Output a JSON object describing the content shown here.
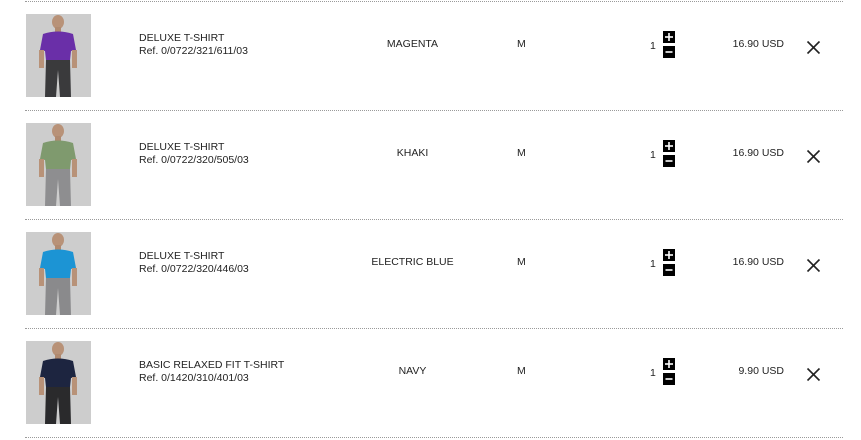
{
  "items": [
    {
      "name": "DELUXE T-SHIRT",
      "ref": "Ref. 0/0722/321/611/03",
      "color": "MAGENTA",
      "size": "M",
      "quantity": "1",
      "price": "16.90 USD",
      "shirt_color": "#6a2fa8",
      "pants_color": "#3a3a3c"
    },
    {
      "name": "DELUXE T-SHIRT",
      "ref": "Ref. 0/0722/320/505/03",
      "color": "KHAKI",
      "size": "M",
      "quantity": "1",
      "price": "16.90 USD",
      "shirt_color": "#7f9a6e",
      "pants_color": "#8e8e90"
    },
    {
      "name": "DELUXE T-SHIRT",
      "ref": "Ref. 0/0722/320/446/03",
      "color": "ELECTRIC BLUE",
      "size": "M",
      "quantity": "1",
      "price": "16.90 USD",
      "shirt_color": "#1c94d4",
      "pants_color": "#8a8a8c"
    },
    {
      "name": "BASIC RELAXED FIT T-SHIRT",
      "ref": "Ref. 0/1420/310/401/03",
      "color": "NAVY",
      "size": "M",
      "quantity": "1",
      "price": "9.90 USD",
      "shirt_color": "#1d2540",
      "pants_color": "#2a2a2c"
    }
  ],
  "icons": {
    "increase": "plus-icon",
    "decrease": "minus-icon",
    "remove": "close-icon"
  }
}
